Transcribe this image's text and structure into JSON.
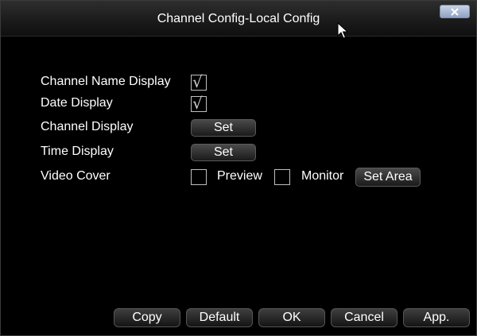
{
  "window": {
    "title": "Channel Config-Local Config",
    "close_label": "x"
  },
  "settings": [
    {
      "label": "Channel Name Display",
      "checked": true
    },
    {
      "label": "Date Display",
      "checked": true
    },
    {
      "label": "Channel Display",
      "button": "Set"
    },
    {
      "label": "Time Display",
      "button": "Set"
    },
    {
      "label": "Video Cover"
    }
  ],
  "video_cover": {
    "preview_label": "Preview",
    "preview_checked": false,
    "monitor_label": "Monitor",
    "monitor_checked": false,
    "set_area_label": "Set Area"
  },
  "footer": {
    "copy": "Copy",
    "default": "Default",
    "ok": "OK",
    "cancel": "Cancel",
    "apply": "App."
  },
  "checkmark_glyph": "√"
}
